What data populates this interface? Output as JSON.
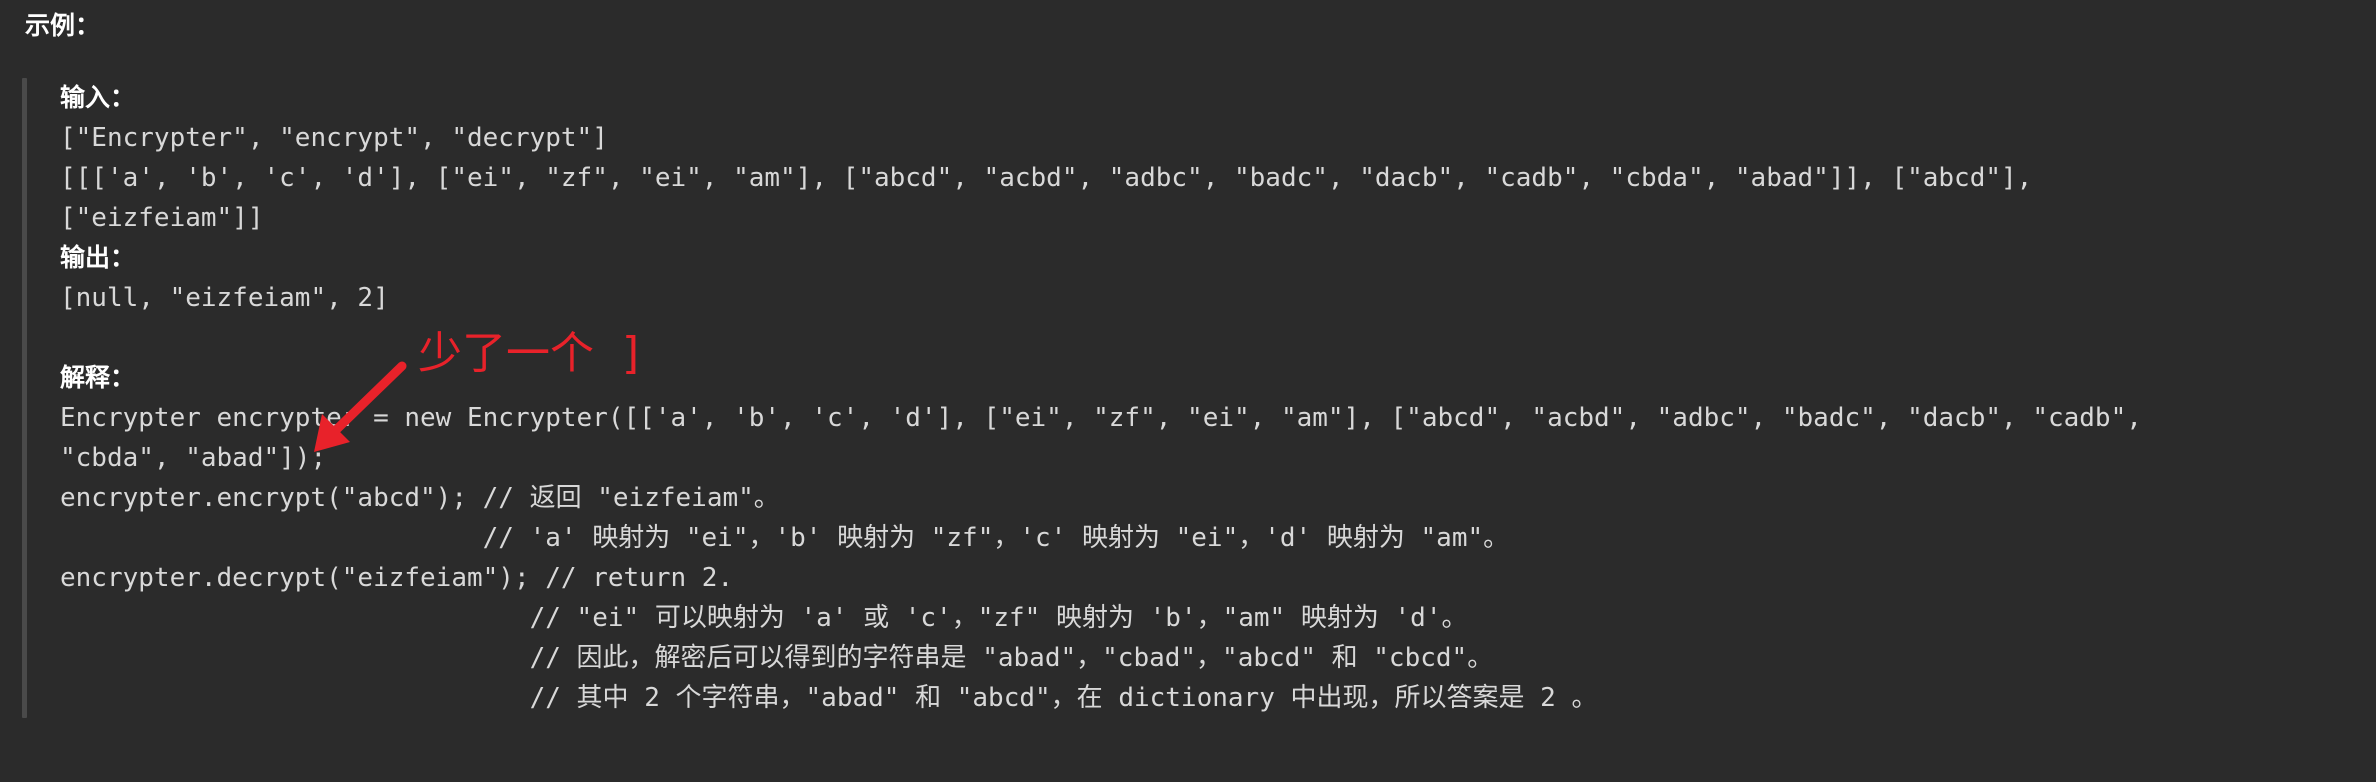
{
  "section": {
    "title": "示例："
  },
  "example": {
    "input_label": "输入：",
    "input_line1": "[\"Encrypter\", \"encrypt\", \"decrypt\"]",
    "input_line2": "[[['a', 'b', 'c', 'd'], [\"ei\", \"zf\", \"ei\", \"am\"], [\"abcd\", \"acbd\", \"adbc\", \"badc\", \"dacb\", \"cadb\", \"cbda\", \"abad\"]], [\"abcd\"],",
    "input_line3": "[\"eizfeiam\"]]",
    "output_label": "输出：",
    "output_line1": "[null, \"eizfeiam\", 2]",
    "explain_label": "解释：",
    "explain_line1": "Encrypter encrypter = new Encrypter([['a', 'b', 'c', 'd'], [\"ei\", \"zf\", \"ei\", \"am\"], [\"abcd\", \"acbd\", \"adbc\", \"badc\", \"dacb\", \"cadb\",",
    "explain_line2": "\"cbda\", \"abad\"]);",
    "explain_line3": "encrypter.encrypt(\"abcd\"); // 返回 \"eizfeiam\"。",
    "explain_line4": "                           // 'a' 映射为 \"ei\"，'b' 映射为 \"zf\"，'c' 映射为 \"ei\"，'d' 映射为 \"am\"。",
    "explain_line5": "encrypter.decrypt(\"eizfeiam\"); // return 2.",
    "explain_line6": "                              // \"ei\" 可以映射为 'a' 或 'c'，\"zf\" 映射为 'b'，\"am\" 映射为 'd'。",
    "explain_line7": "                              // 因此，解密后可以得到的字符串是 \"abad\"，\"cbad\"，\"abcd\" 和 \"cbcd\"。",
    "explain_line8": "                              // 其中 2 个字符串，\"abad\" 和 \"abcd\"，在 dictionary 中出现，所以答案是 2 。"
  },
  "annotation": {
    "text": "少了一个  ]",
    "color": "#e8222a"
  }
}
